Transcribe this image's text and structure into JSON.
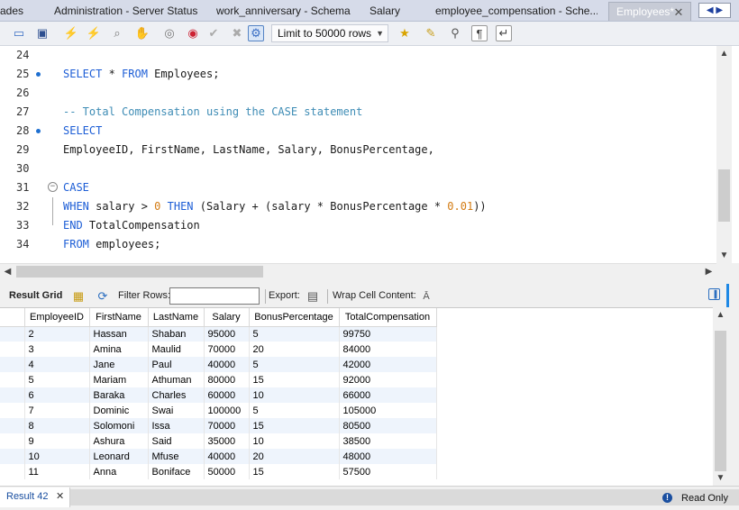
{
  "tabs": [
    {
      "label": "ades"
    },
    {
      "label": "Administration - Server Status"
    },
    {
      "label": "work_anniversary - Schema"
    },
    {
      "label": "Salary"
    },
    {
      "label": "employee_compensation - Sche..."
    },
    {
      "label": "Employees*"
    }
  ],
  "toolbar": {
    "limit_label": "Limit to 50000 rows"
  },
  "editor": {
    "lines": [
      {
        "num": "24",
        "text": ""
      },
      {
        "num": "25",
        "text": "SELECT * FROM Employees;"
      },
      {
        "num": "26",
        "text": ""
      },
      {
        "num": "27",
        "text": "-- Total Compensation using the CASE statement"
      },
      {
        "num": "28",
        "text": "SELECT"
      },
      {
        "num": "29",
        "text": "EmployeeID, FirstName, LastName, Salary, BonusPercentage,"
      },
      {
        "num": "30",
        "text": ""
      },
      {
        "num": "31",
        "text": "CASE"
      },
      {
        "num": "32",
        "text": "WHEN salary > 0 THEN (Salary + (salary * BonusPercentage * 0.01))"
      },
      {
        "num": "33",
        "text": "END TotalCompensation"
      },
      {
        "num": "34",
        "text": "FROM employees;"
      }
    ]
  },
  "result_toolbar": {
    "result_grid": "Result Grid",
    "filter_rows": "Filter Rows:",
    "export": "Export:",
    "wrap_cell": "Wrap Cell Content:"
  },
  "grid": {
    "columns": [
      "EmployeeID",
      "FirstName",
      "LastName",
      "Salary",
      "BonusPercentage",
      "TotalCompensation"
    ],
    "rows": [
      [
        "2",
        "Hassan",
        "Shaban",
        "95000",
        "5",
        "99750"
      ],
      [
        "3",
        "Amina",
        "Maulid",
        "70000",
        "20",
        "84000"
      ],
      [
        "4",
        "Jane",
        "Paul",
        "40000",
        "5",
        "42000"
      ],
      [
        "5",
        "Mariam",
        "Athuman",
        "80000",
        "15",
        "92000"
      ],
      [
        "6",
        "Baraka",
        "Charles",
        "60000",
        "10",
        "66000"
      ],
      [
        "7",
        "Dominic",
        "Swai",
        "100000",
        "5",
        "105000"
      ],
      [
        "8",
        "Solomoni",
        "Issa",
        "70000",
        "15",
        "80500"
      ],
      [
        "9",
        "Ashura",
        "Said",
        "35000",
        "10",
        "38500"
      ],
      [
        "10",
        "Leonard",
        "Mfuse",
        "40000",
        "20",
        "48000"
      ],
      [
        "11",
        "Anna",
        "Boniface",
        "50000",
        "15",
        "57500"
      ]
    ]
  },
  "status": {
    "result_tab": "Result 42",
    "read_only": "Read Only"
  }
}
